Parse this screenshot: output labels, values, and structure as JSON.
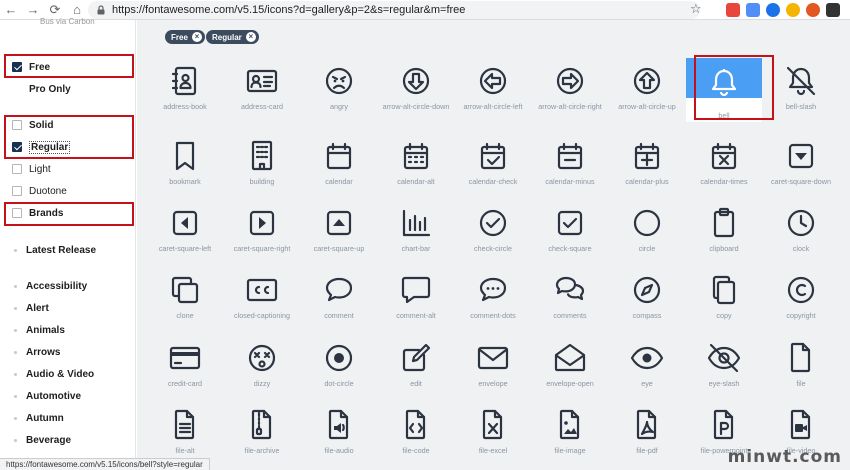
{
  "browser": {
    "url": "https://fontawesome.com/v5.15/icons?d=gallery&p=2&s=regular&m=free",
    "status_url": "https://fontawesome.com/v5.15/icons/bell?style=regular"
  },
  "sidebar": {
    "top_text": "Bus via Carbon",
    "filters": [
      {
        "label": "Free",
        "checked": true
      },
      {
        "label": "Pro Only",
        "checked": false
      },
      {
        "label": "Solid",
        "checked": false
      },
      {
        "label": "Regular",
        "checked": true
      },
      {
        "label": "Light",
        "checked": false
      },
      {
        "label": "Duotone",
        "checked": false
      },
      {
        "label": "Brands",
        "checked": false
      }
    ],
    "categories": [
      "Latest Release",
      "Accessibility",
      "Alert",
      "Animals",
      "Arrows",
      "Audio & Video",
      "Automotive",
      "Autumn",
      "Beverage"
    ]
  },
  "chips": [
    "Free",
    "Regular"
  ],
  "icons": [
    "address-book",
    "address-card",
    "angry",
    "arrow-alt-circle-down",
    "arrow-alt-circle-left",
    "arrow-alt-circle-right",
    "arrow-alt-circle-up",
    "bell",
    "bell-slash",
    "bookmark",
    "building",
    "calendar",
    "calendar-alt",
    "calendar-check",
    "calendar-minus",
    "calendar-plus",
    "calendar-times",
    "caret-square-down",
    "caret-square-left",
    "caret-square-right",
    "caret-square-up",
    "chart-bar",
    "check-circle",
    "check-square",
    "circle",
    "clipboard",
    "clock",
    "clone",
    "closed-captioning",
    "comment",
    "comment-alt",
    "comment-dots",
    "comments",
    "compass",
    "copy",
    "copyright",
    "credit-card",
    "dizzy",
    "dot-circle",
    "edit",
    "envelope",
    "envelope-open",
    "eye",
    "eye-slash",
    "file",
    "file-alt",
    "file-archive",
    "file-audio",
    "file-code",
    "file-excel",
    "file-image",
    "file-pdf",
    "file-powerpoint",
    "file-video"
  ],
  "selected_icon": "bell",
  "watermark": "minwt.com",
  "colors": {
    "icon": "#2b3440",
    "label": "#8a96a3",
    "selected": "#4a9ff5",
    "highlight": "#c4121b",
    "chip": "#3c4b5e"
  }
}
